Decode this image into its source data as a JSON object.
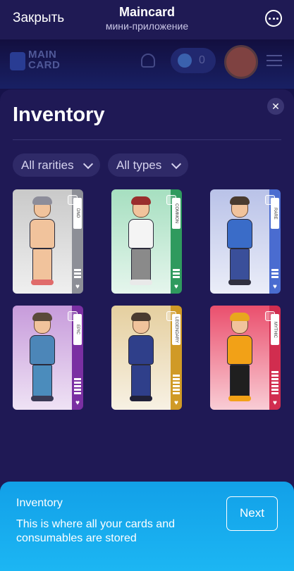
{
  "telegram": {
    "close_label": "Закрыть",
    "title": "Maincard",
    "subtitle": "мини-приложение"
  },
  "app_header": {
    "logo_line1": "MAIN",
    "logo_line2": "CARD",
    "coin_count": "0"
  },
  "inventory": {
    "title": "Inventory",
    "filters": [
      {
        "label": "All rarities"
      },
      {
        "label": "All types"
      }
    ],
    "cards": [
      {
        "rarity": "DNO",
        "bg": "#c9c9c9",
        "strip": "#8d8f97",
        "hair": "#8d8d9a",
        "torso": "#f1c39c",
        "legs": "#f1c39c",
        "shoes": "#e06b6b",
        "bars": 3
      },
      {
        "rarity": "COMMON",
        "bg": "#a6dfc0",
        "strip": "#2f9a5e",
        "hair": "#9a2d2d",
        "torso": "#f4f4f4",
        "legs": "#8a8a8a",
        "shoes": "#e9e9e9",
        "bars": 3
      },
      {
        "rarity": "RARE",
        "bg": "#b9c2e8",
        "strip": "#4a6cd0",
        "hair": "#4a3b2f",
        "torso": "#3a6cc8",
        "legs": "#3a4f9a",
        "shoes": "#303040",
        "bars": 3
      },
      {
        "rarity": "EPIC",
        "bg": "#c79bdb",
        "strip": "#7a2fa2",
        "hair": "#5a4a3a",
        "torso": "#4c86b8",
        "legs": "#4b8cbc",
        "shoes": "#3a3a55",
        "bars": 5
      },
      {
        "rarity": "LEGENDARY",
        "bg": "#e5cf9f",
        "strip": "#d09a26",
        "hair": "#4a3b30",
        "torso": "#2f3f8a",
        "legs": "#2f3f8a",
        "shoes": "#202038",
        "bars": 6
      },
      {
        "rarity": "MYTHIC",
        "bg": "#ea4f6d",
        "strip": "#d12d4f",
        "hair": "#e8a71e",
        "torso": "#f2a117",
        "legs": "#1f1f1f",
        "shoes": "#f2a117",
        "bars": 7
      }
    ]
  },
  "tutorial": {
    "title": "Inventory",
    "text": "This is where all your cards and consumables are stored",
    "next_label": "Next"
  }
}
